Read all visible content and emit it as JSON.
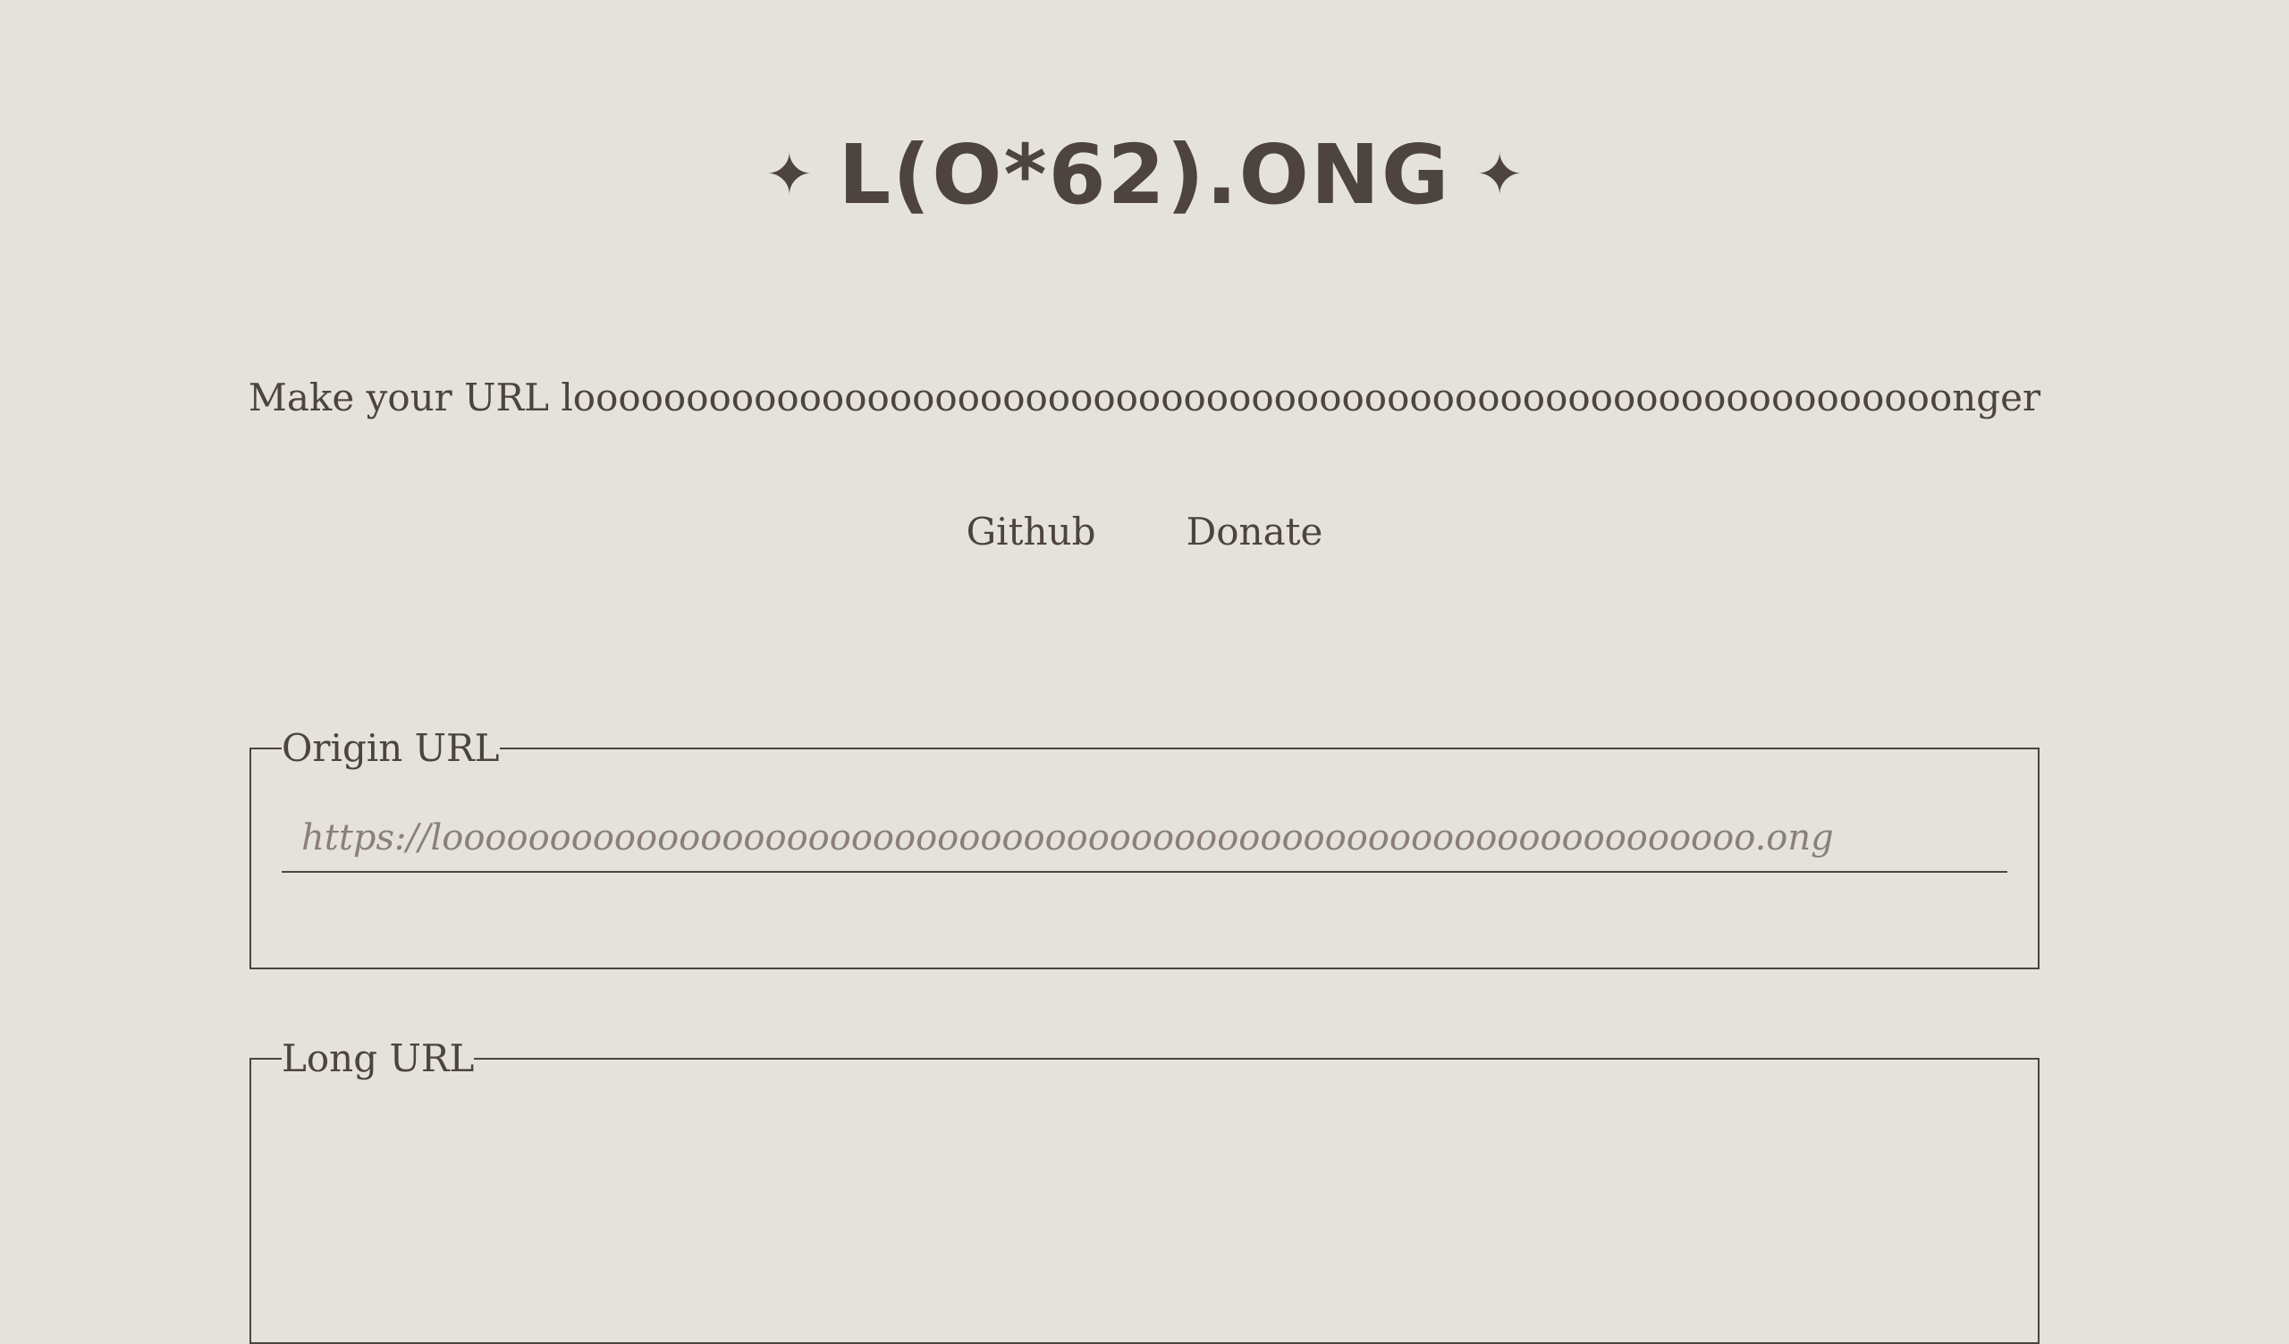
{
  "header": {
    "title": "L(O*62).ONG",
    "left_star": "✦",
    "right_star": "✦"
  },
  "tagline": "Make your URL looooooooooooooooooooooooooooooooooooooooooooooooooooooooooooonger",
  "nav": {
    "github": "Github",
    "donate": "Donate"
  },
  "origin": {
    "legend": "Origin URL",
    "placeholder": "https://looooooooooooooooooooooooooooooooooooooooooooooooooooooooooooo.ong",
    "value": ""
  },
  "long": {
    "legend": "Long URL",
    "value": ""
  }
}
